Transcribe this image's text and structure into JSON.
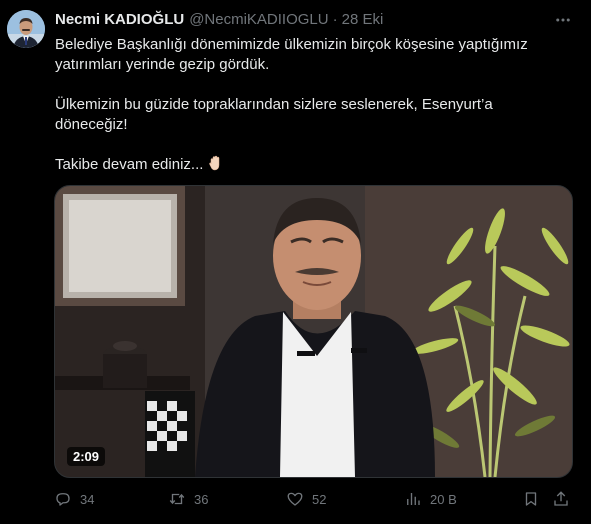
{
  "tweet": {
    "author_name": "Necmi KADIOĞLU",
    "author_handle": "@NecmiKADIIOGLU",
    "separator": "·",
    "timestamp": "28 Eki",
    "text_lines": [
      "Belediye Başkanlığı dönemimizde ülkemizin birçok köşesine yaptığımız",
      "yatırımları yerinde gezip gördük.",
      "Ülkemizin bu güzide topraklarından sizlere seslenerek, Esenyurt’a",
      "döneceğiz!",
      "Takibe devam ediniz..."
    ],
    "video": {
      "duration": "2:09"
    },
    "actions": {
      "replies": "34",
      "reposts": "36",
      "likes": "52",
      "views": "20 B"
    }
  },
  "icons": {
    "more": "more-icon",
    "reply": "reply-icon",
    "repost": "repost-icon",
    "like": "heart-icon",
    "views": "views-icon",
    "bookmark": "bookmark-icon",
    "share": "share-icon",
    "hand_emoji": "raised-hand-icon"
  },
  "colors": {
    "background": "#000000",
    "text": "#e7e9ea",
    "muted": "#71767b"
  }
}
